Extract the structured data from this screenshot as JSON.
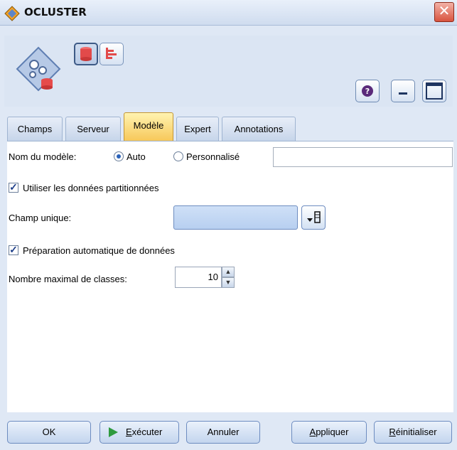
{
  "window": {
    "title": "OCLUSTER",
    "close_glyph": "✕",
    "accent": "#f7c85a",
    "close_color": "#d8533f"
  },
  "toolbar": {
    "icons": [
      "node-database-icon",
      "preview-table-icon",
      "chart-icon",
      "help-icon",
      "minimize-icon",
      "maximize-icon"
    ],
    "help_glyph": "?"
  },
  "tabs": [
    {
      "label": "Champs",
      "active": false
    },
    {
      "label": "Serveur",
      "active": false
    },
    {
      "label": "Modèle",
      "active": true
    },
    {
      "label": "Expert",
      "active": false
    },
    {
      "label": "Annotations",
      "active": false
    }
  ],
  "model": {
    "name_label": "Nom du modèle:",
    "auto_label": "Auto",
    "custom_label": "Personnalisé",
    "selected": "Auto",
    "custom_value": "",
    "use_partitioned_label": "Utiliser les données partitionnées",
    "use_partitioned_checked": true,
    "unique_field_label": "Champ unique:",
    "unique_field_value": "",
    "auto_prep_label": "Préparation automatique de données",
    "auto_prep_checked": true,
    "max_clusters_label": "Nombre maximal de classes:",
    "max_clusters_value": "10"
  },
  "buttons": {
    "ok": "OK",
    "run_prefix": "E",
    "run_rest": "xécuter",
    "cancel": "Annuler",
    "apply_prefix": "A",
    "apply_rest": "ppliquer",
    "reset_prefix": "R",
    "reset_rest": "éinitialiser"
  }
}
